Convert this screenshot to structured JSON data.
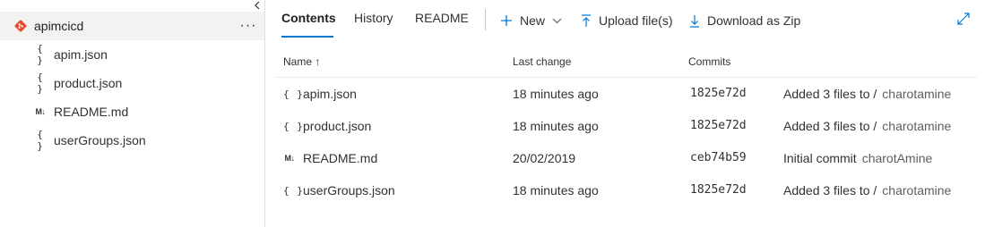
{
  "sidebar": {
    "repo_name": "apimcicd",
    "more_label": "···",
    "items": [
      {
        "icon": "braces",
        "label": "apim.json"
      },
      {
        "icon": "md",
        "label": "product.json"
      },
      {
        "icon": "md",
        "label": "README.md"
      },
      {
        "icon": "braces",
        "label": "userGroups.json"
      }
    ],
    "icon_glyphs": {
      "braces": "{ }",
      "md": "M↓"
    }
  },
  "tabs": [
    {
      "label": "Contents",
      "active": true
    },
    {
      "label": "History",
      "active": false
    },
    {
      "label": "README",
      "active": false
    }
  ],
  "toolbar": {
    "new_label": "New",
    "upload_label": "Upload file(s)",
    "download_label": "Download as Zip"
  },
  "table": {
    "headers": {
      "name": "Name ↑",
      "last_change": "Last change",
      "commits": "Commits"
    },
    "rows": [
      {
        "icon": "braces",
        "name": "apim.json",
        "last_change": "18 minutes ago",
        "commit": "1825e72d",
        "message": "Added 3 files to /",
        "author": "charotamine"
      },
      {
        "icon": "braces",
        "name": "product.json",
        "last_change": "18 minutes ago",
        "commit": "1825e72d",
        "message": "Added 3 files to /",
        "author": "charotamine"
      },
      {
        "icon": "md",
        "name": "README.md",
        "last_change": "20/02/2019",
        "commit": "ceb74b59",
        "message": "Initial commit",
        "author": "charotAmine"
      },
      {
        "icon": "braces",
        "name": "userGroups.json",
        "last_change": "18 minutes ago",
        "commit": "1825e72d",
        "message": "Added 3 files to /",
        "author": "charotamine"
      }
    ]
  },
  "colors": {
    "accent": "#0078d4",
    "git_icon": "#e8472b",
    "selected_bg": "#f3f2f1"
  }
}
